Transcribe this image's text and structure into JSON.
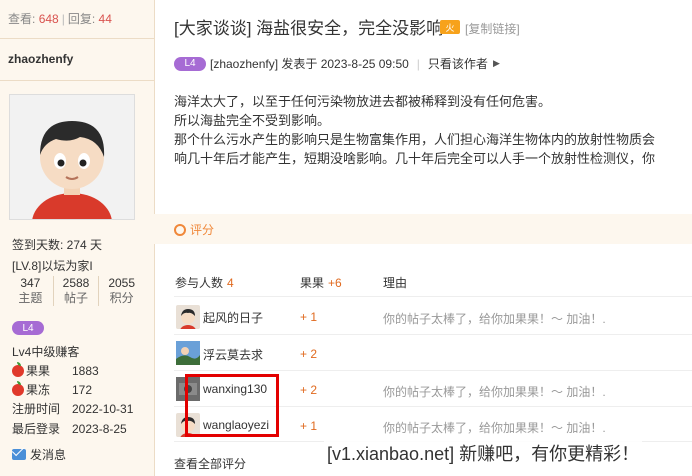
{
  "sidebar": {
    "views_label": "查看:",
    "views": "648",
    "replies_label": "回复:",
    "replies": "44",
    "username": "zhaozhenfy",
    "signin_days": "签到天数: 274 天",
    "level_title": "[LV.8]以坛为家I",
    "counts": [
      {
        "value": "347",
        "label": "主题"
      },
      {
        "value": "2588",
        "label": "帖子"
      },
      {
        "value": "2055",
        "label": "积分"
      }
    ],
    "badge": "L4",
    "rank": "Lv4中级赚客",
    "fruit_label": "果果",
    "fruit_value": "1883",
    "frozen_label": "果冻",
    "frozen_value": "172",
    "reg_label": "注册时间",
    "reg_value": "2022-10-31",
    "last_label": "最后登录",
    "last_value": "2023-8-25",
    "message": "发消息"
  },
  "post": {
    "title": "[大家谈谈] 海盐很安全，完全没影响",
    "fire_badge": "火",
    "copy_link": "[复制链接]",
    "badge": "L4",
    "author_line": "[zhaozhenfy] 发表于 2023-8-25 09:50",
    "only_author": "只看该作者",
    "lines": [
      "海洋太大了，以至于任何污染物放进去都被稀释到没有任何危害。",
      "所以海盐完全不受到影响。",
      "那个什么污水产生的影响只是生物富集作用，人们担心海洋生物体内的放射性物质会",
      "响几十年后才能产生，短期没啥影响。几十年后完全可以人手一个放射性检测仪，你"
    ]
  },
  "rating": {
    "section_label": "评分",
    "col_people": "参与人数",
    "people_count": "4",
    "col_fruit": "果果",
    "fruit_total": "+6",
    "col_reason": "理由",
    "rows": [
      {
        "name": "起风的日子",
        "score": "+ 1",
        "reason": "你的帖子太棒了，给你加果果！～ 加油！."
      },
      {
        "name": "浮云莫去求",
        "score": "+ 2",
        "reason": ""
      },
      {
        "name": "wanxing130",
        "score": "+ 2",
        "reason": "你的帖子太棒了，给你加果果！～ 加油！."
      },
      {
        "name": "wanglaoyezi",
        "score": "+ 1",
        "reason": "你的帖子太棒了，给你加果果！～ 加油！."
      }
    ],
    "view_all": "查看全部评分"
  },
  "watermark": "[v1.xianbao.net] 新赚吧，有你更精彩！",
  "colors": {
    "accent": "#e06a1f",
    "badge": "#a66bd4",
    "highlight": "#e30000"
  }
}
